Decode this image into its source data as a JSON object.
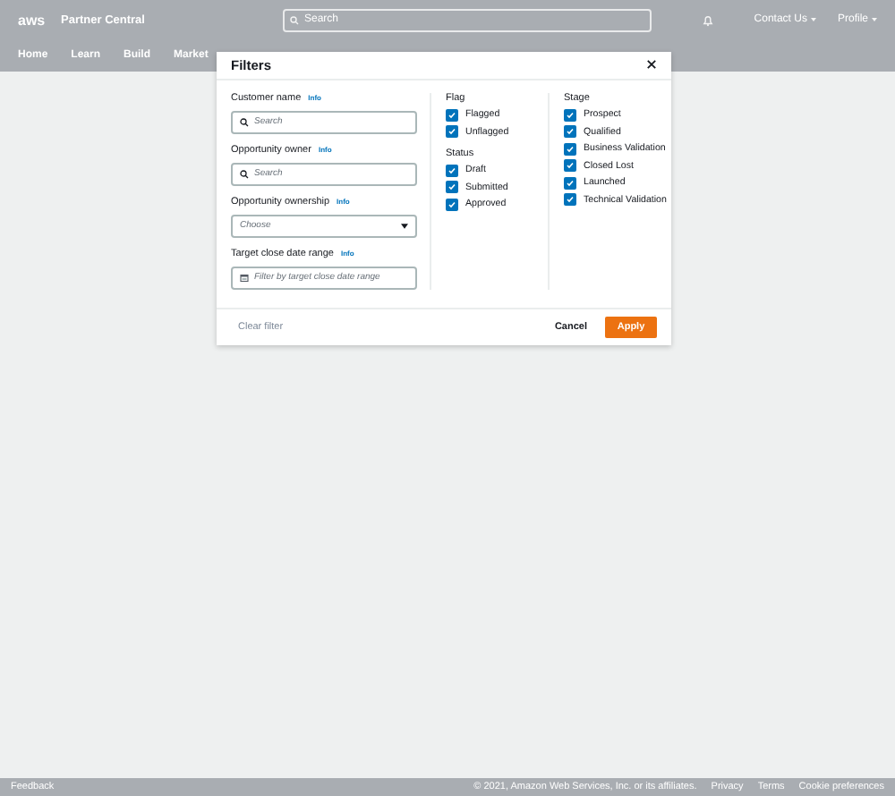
{
  "header": {
    "logo": "aws",
    "title": "Partner Central",
    "search": {
      "placeholder": "Search"
    },
    "menus": [
      "Contact Us",
      "Profile"
    ]
  },
  "nav": [
    "Home",
    "Learn",
    "Build",
    "Market"
  ],
  "modal": {
    "title": "Filters",
    "fields": [
      {
        "label": "Customer name",
        "info": "Info",
        "kind": "search",
        "placeholder": "Search"
      },
      {
        "label": "Opportunity owner",
        "info": "Info",
        "kind": "search",
        "placeholder": "Search"
      },
      {
        "label": "Opportunity ownership",
        "info": "Info",
        "kind": "select",
        "placeholder": "Choose"
      },
      {
        "label": "Target close date range",
        "info": "Info",
        "kind": "date",
        "placeholder": "Filter by target close date range"
      }
    ],
    "columns": [
      [
        {
          "title": "Flag",
          "options": [
            {
              "label": "Flagged",
              "checked": true
            },
            {
              "label": "Unflagged",
              "checked": true
            }
          ]
        },
        {
          "title": "Status",
          "options": [
            {
              "label": "Draft",
              "checked": true
            },
            {
              "label": "Submitted",
              "checked": true
            },
            {
              "label": "Approved",
              "checked": true
            }
          ]
        }
      ],
      [
        {
          "title": "Stage",
          "options": [
            {
              "label": "Prospect",
              "checked": true
            },
            {
              "label": "Qualified",
              "checked": true
            },
            {
              "label": "Business Validation",
              "checked": true
            },
            {
              "label": "Closed Lost",
              "checked": true
            },
            {
              "label": "Launched",
              "checked": true
            },
            {
              "label": "Technical Validation",
              "checked": true
            }
          ]
        }
      ]
    ],
    "clear": "Clear filter",
    "cancel": "Cancel",
    "apply": "Apply"
  },
  "footer": {
    "feedback": "Feedback",
    "copyright": "© 2021, Amazon Web Services, Inc. or its affiliates.",
    "links": [
      "Privacy",
      "Terms",
      "Cookie preferences"
    ]
  }
}
